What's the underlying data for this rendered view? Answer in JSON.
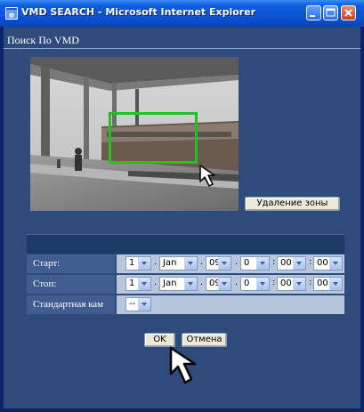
{
  "window": {
    "title": "VMD SEARCH - Microsoft Internet Explorer",
    "icon": "ie-icon",
    "controls": [
      "minimize",
      "maximize",
      "close"
    ]
  },
  "page": {
    "heading": "Поиск По VMD"
  },
  "camera": {
    "zone_color": "#22c022"
  },
  "buttons": {
    "delete_zone": "Удаление зоны",
    "ok": "OK",
    "cancel": "Отмена"
  },
  "form": {
    "start": {
      "label": "Старт:",
      "day": "1",
      "month": "Jan",
      "year": "09",
      "hour": "0",
      "minute": "00",
      "second": "00"
    },
    "stop": {
      "label": "Стоп:",
      "day": "1",
      "month": "Jan",
      "year": "09",
      "hour": "0",
      "minute": "00",
      "second": "00"
    },
    "camera": {
      "label": "Стандартная кам",
      "value": "--"
    },
    "separators": {
      "date": ".",
      "time": ":"
    }
  },
  "colors": {
    "titlebar": "#0a50d0",
    "client_bg": "#2e4b7c",
    "label_bg": "#3f5d8e",
    "field_bg": "#b8c7de"
  }
}
